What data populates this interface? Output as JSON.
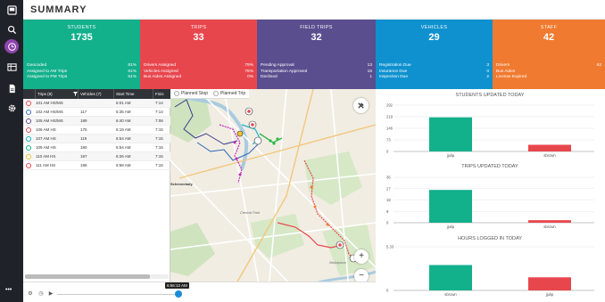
{
  "header": {
    "title": "SUMMARY"
  },
  "sidebar": {
    "items": [
      {
        "icon": "app-logo-icon"
      },
      {
        "icon": "search-icon"
      },
      {
        "icon": "clock-icon",
        "active": true
      },
      {
        "icon": "table-icon"
      },
      {
        "icon": "document-icon"
      },
      {
        "icon": "gear-icon"
      }
    ],
    "more_label": "•••"
  },
  "tiles": [
    {
      "label": "STUDENTS",
      "value": "1735",
      "color": "#13b08c",
      "rows": [
        {
          "k": "Geocoded",
          "v": "81%"
        },
        {
          "k": "Assigned to AM Trips",
          "v": "61%"
        },
        {
          "k": "Assigned to PM Trips",
          "v": "61%"
        }
      ]
    },
    {
      "label": "TRIPS",
      "value": "33",
      "color": "#e8464d",
      "rows": [
        {
          "k": "Drivers Assigned",
          "v": "79%"
        },
        {
          "k": "Vehicles Assigned",
          "v": "76%"
        },
        {
          "k": "Bus Aides Assigned",
          "v": "0%"
        }
      ]
    },
    {
      "label": "FIELD TRIPS",
      "value": "32",
      "color": "#5b4e8e",
      "rows": [
        {
          "k": "Pending Approval",
          "v": "13"
        },
        {
          "k": "Transportation Approved",
          "v": "16"
        },
        {
          "k": "Declined",
          "v": "1"
        }
      ]
    },
    {
      "label": "VEHICLES",
      "value": "29",
      "color": "#0f91cf",
      "rows": [
        {
          "k": "Registration Due",
          "v": "3"
        },
        {
          "k": "Insurance Due",
          "v": "0"
        },
        {
          "k": "Inspection Due",
          "v": "2"
        }
      ]
    },
    {
      "label": "STAFF",
      "value": "42",
      "color": "#f07a2f",
      "rows": [
        {
          "k": "Drivers",
          "v": "62"
        },
        {
          "k": "Bus Aides",
          "v": ""
        },
        {
          "k": "License Expired",
          "v": ""
        }
      ]
    }
  ],
  "grid": {
    "columns": [
      "Trips (8)",
      "Vehicles (7)",
      "Start Time",
      "Finis"
    ],
    "rows": [
      {
        "trip": "101 AM HS/MS",
        "vehicle": "",
        "start": "6:01 AM",
        "finish": "7:14",
        "color": "#e8464d"
      },
      {
        "trip": "102 AM HS/MS",
        "vehicle": "117",
        "start": "6:35 AM",
        "finish": "7:14",
        "color": "#3a6fc4"
      },
      {
        "trip": "105 AM HS/MS",
        "vehicle": "189",
        "start": "6:40 AM",
        "finish": "7:08",
        "color": "#5b4e8e"
      },
      {
        "trip": "106 AM HS",
        "vehicle": "175",
        "start": "6:19 AM",
        "finish": "7:15",
        "color": "#e8464d"
      },
      {
        "trip": "107 AM HS",
        "vehicle": "119",
        "start": "6:54 AM",
        "finish": "7:15",
        "color": "#13b0c0"
      },
      {
        "trip": "109 AM HS",
        "vehicle": "180",
        "start": "6:54 AM",
        "finish": "7:15",
        "color": "#13b08c"
      },
      {
        "trip": "110 AM HS",
        "vehicle": "197",
        "start": "6:26 AM",
        "finish": "7:15",
        "color": "#f0c330"
      },
      {
        "trip": "111 AM HS",
        "vehicle": "196",
        "start": "6:58 AM",
        "finish": "7:15",
        "color": "#e8464d"
      }
    ]
  },
  "map": {
    "legend": [
      {
        "label": "Planned Stop",
        "color": "#ffffff"
      },
      {
        "label": "Planned Trip",
        "color": "#ffffff"
      }
    ],
    "zoom_in": "+",
    "zoom_out": "−",
    "attribution": "Esri, HERE, Garmin, INCREMENT P, NGA, USGS",
    "places": [
      {
        "text": "Schenectady",
        "bold": true
      },
      {
        "text": "Central Park"
      },
      {
        "text": "Niskayuna"
      }
    ]
  },
  "playback": {
    "time": "6:56:12 AM"
  },
  "chart_data": [
    {
      "type": "bar",
      "title": "STUDENTS UPDATED TODAY",
      "categories": [
        "jjulip",
        "sbrown"
      ],
      "values": [
        215,
        42
      ],
      "colors": [
        "#13b08c",
        "#e8464d"
      ],
      "yticks": [
        0,
        73,
        146,
        219,
        292
      ],
      "ylim": [
        0,
        292
      ]
    },
    {
      "type": "bar",
      "title": "TRIPS UPDATED TODAY",
      "categories": [
        "jjulip",
        "sbrown"
      ],
      "values": [
        26,
        2
      ],
      "colors": [
        "#13b08c",
        "#e8464d"
      ],
      "yticks": [
        0,
        9,
        18,
        27,
        36
      ],
      "ylim": [
        0,
        36
      ]
    },
    {
      "type": "bar",
      "title": "HOURS LOGGED IN TODAY",
      "categories": [
        "sbrown",
        "jjulip"
      ],
      "values": [
        3.1,
        1.6
      ],
      "colors": [
        "#13b08c",
        "#e8464d"
      ],
      "yticks": [
        0,
        5.33
      ],
      "ylim": [
        0,
        5.33
      ]
    }
  ]
}
